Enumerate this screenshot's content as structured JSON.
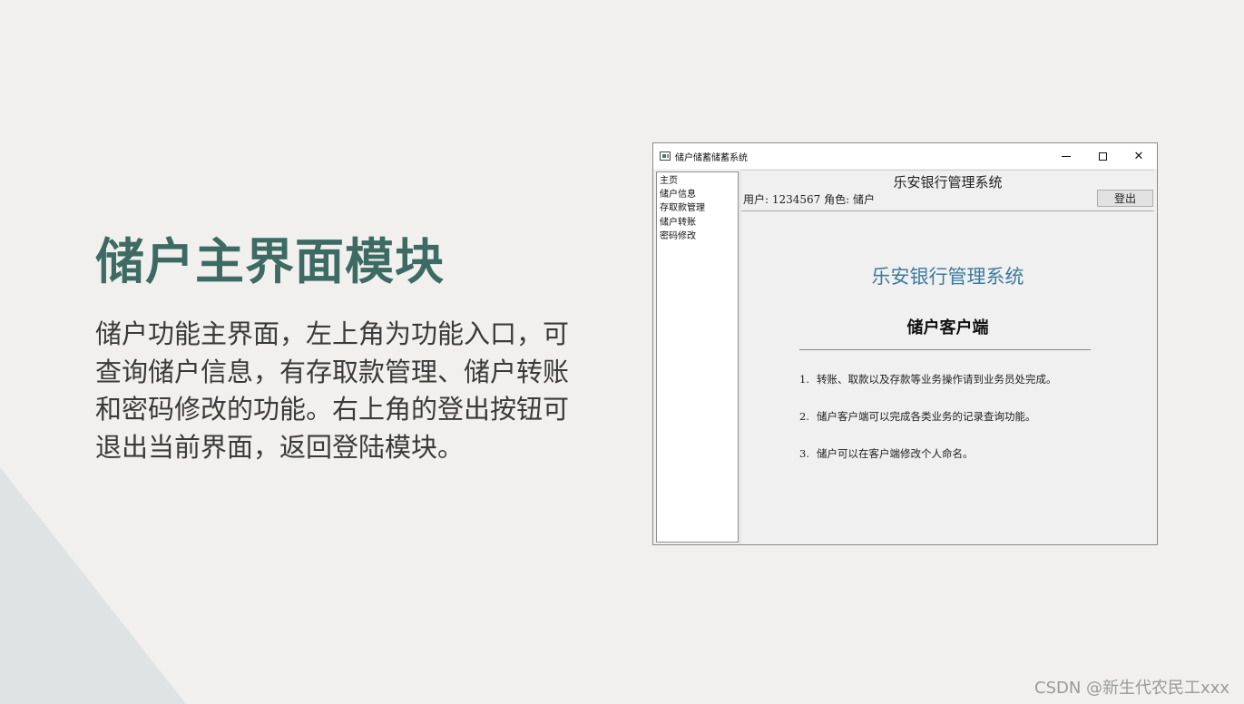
{
  "slide": {
    "title": "储户主界面模块",
    "description": "储户功能主界面，左上角为功能入口，可查询储户信息，有存取款管理、储户转账和密码修改的功能。右上角的登出按钮可退出当前界面，返回登陆模块。",
    "watermark": "CSDN @新生代农民工xxx"
  },
  "window": {
    "title": "储户储蓄储蓄系统",
    "controls": {
      "minimize": "minimize-icon",
      "maximize": "maximize-icon",
      "close": "close-icon"
    }
  },
  "sidebar": {
    "items": [
      {
        "label": "主页"
      },
      {
        "label": "储户信息"
      },
      {
        "label": "存取款管理"
      },
      {
        "label": "储户转账"
      },
      {
        "label": "密码修改"
      }
    ]
  },
  "header": {
    "bank_name": "乐安银行管理系统",
    "user_info": "用户: 1234567 角色: 储户",
    "logout_label": "登出"
  },
  "content": {
    "title": "乐安银行管理系统",
    "subtitle": "储户客户端",
    "notices": [
      {
        "num": "1.",
        "text": "转账、取款以及存款等业务操作请到业务员处完成。"
      },
      {
        "num": "2.",
        "text": "储户客户端可以完成各类业务的记录查询功能。"
      },
      {
        "num": "3.",
        "text": "储户可以在客户端修改个人命名。"
      }
    ]
  },
  "colors": {
    "title_green": "#3d6b63",
    "content_title_blue": "#3c7b9b",
    "background": "#f1f0ee"
  }
}
